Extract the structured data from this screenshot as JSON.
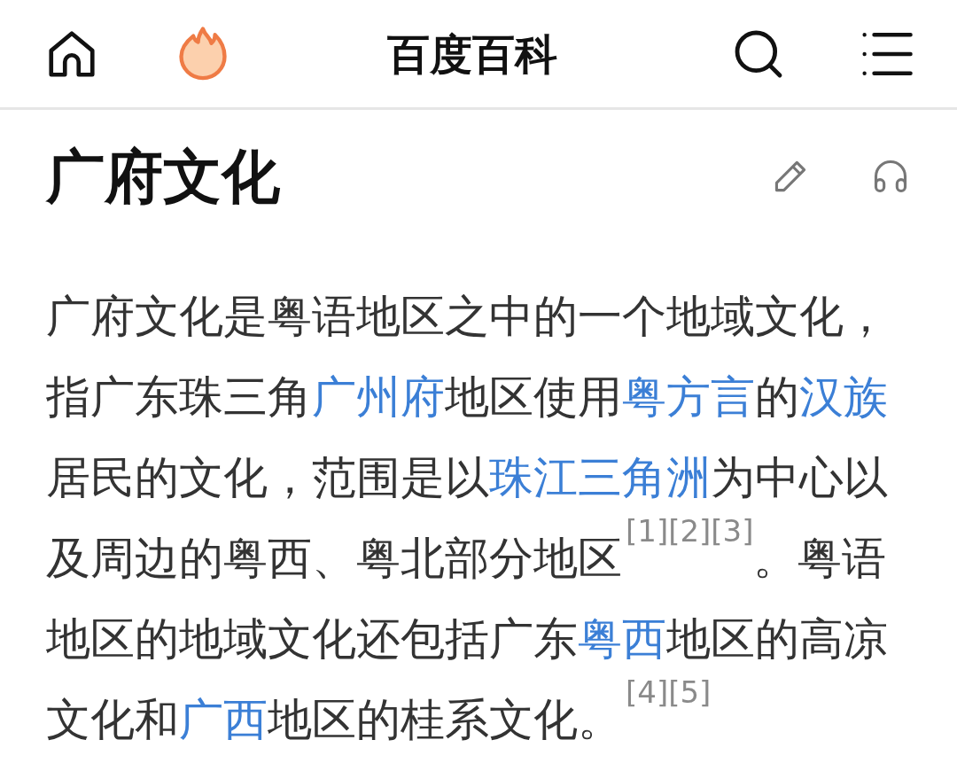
{
  "header": {
    "title": "百度百科"
  },
  "article": {
    "title": "广府文化",
    "paragraph": [
      {
        "kind": "text",
        "text": "广府文化是粤语地区之中的一个地域文化，指广东珠三角"
      },
      {
        "kind": "link",
        "text": "广州府"
      },
      {
        "kind": "text",
        "text": "地区使用"
      },
      {
        "kind": "link",
        "text": "粤方言"
      },
      {
        "kind": "text",
        "text": "的"
      },
      {
        "kind": "link",
        "text": "汉族"
      },
      {
        "kind": "text",
        "text": "居民的文化，范围是以"
      },
      {
        "kind": "link",
        "text": "珠江三角洲"
      },
      {
        "kind": "text",
        "text": "为中心以及周边的粤西、粤北部分地区"
      },
      {
        "kind": "ref",
        "text": "[1][2][3]"
      },
      {
        "kind": "text",
        "text": "。粤语地区的地域文化还包括广东"
      },
      {
        "kind": "link",
        "text": "粤西"
      },
      {
        "kind": "text",
        "text": "地区的高凉文化和"
      },
      {
        "kind": "link",
        "text": "广西"
      },
      {
        "kind": "text",
        "text": "地区的桂系文化。"
      },
      {
        "kind": "ref",
        "text": "[4][5]"
      }
    ]
  }
}
